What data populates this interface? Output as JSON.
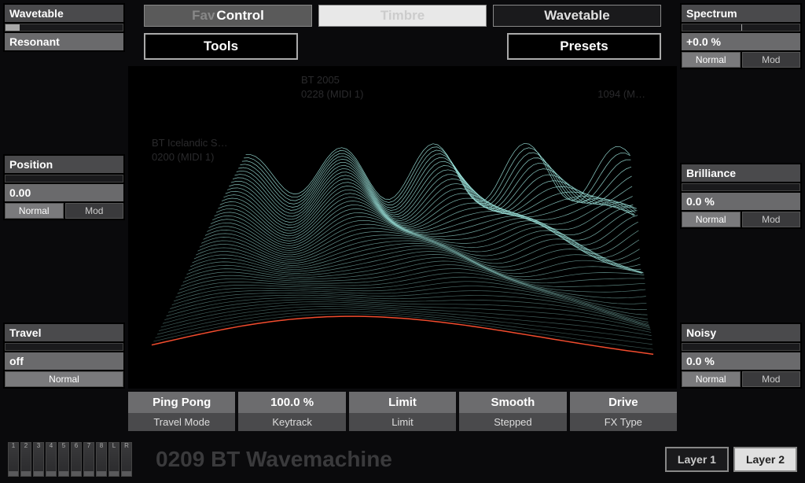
{
  "tabs": {
    "control_faded": "Fav",
    "control": "Control",
    "timbre": "Timbre",
    "wavetable": "Wavetable"
  },
  "header_buttons": {
    "tools": "Tools",
    "presets": "Presets"
  },
  "left_params": {
    "wavetable": {
      "label": "Wavetable",
      "value": "Resonant",
      "fill": 12,
      "modes": null
    },
    "position": {
      "label": "Position",
      "value": "0.00",
      "fill": 0,
      "mode_normal": "Normal",
      "mode_mod": "Mod"
    },
    "travel": {
      "label": "Travel",
      "value": "off",
      "fill": 0,
      "mode_normal": "Normal"
    }
  },
  "right_params": {
    "spectrum": {
      "label": "Spectrum",
      "value": "+0.0 %",
      "fill": 50,
      "mode_normal": "Normal",
      "mode_mod": "Mod"
    },
    "brilliance": {
      "label": "Brilliance",
      "value": "0.0 %",
      "fill": 0,
      "mode_normal": "Normal",
      "mode_mod": "Mod"
    },
    "noisy": {
      "label": "Noisy",
      "value": "0.0 %",
      "fill": 0,
      "mode_normal": "Normal",
      "mode_mod": "Mod"
    }
  },
  "bottom_params": [
    {
      "value": "Ping Pong",
      "label": "Travel Mode"
    },
    {
      "value": "100.0 %",
      "label": "Keytrack"
    },
    {
      "value": "Limit",
      "label": "Limit"
    },
    {
      "value": "Smooth",
      "label": "Stepped"
    },
    {
      "value": "Drive",
      "label": "FX Type"
    }
  ],
  "meters": [
    "1",
    "2",
    "3",
    "4",
    "5",
    "6",
    "7",
    "8",
    "L",
    "R"
  ],
  "preset_name": "0209 BT Wavemachine",
  "layers": {
    "layer1": "Layer 1",
    "layer2": "Layer 2"
  },
  "ghost": {
    "bt2005": "BT 2005",
    "m0228": "0228 (MIDI 1)",
    "bticeland": "BT Icelandic S…",
    "m0200": "0200 (MIDI 1)",
    "t1094": "1094 (M…"
  }
}
